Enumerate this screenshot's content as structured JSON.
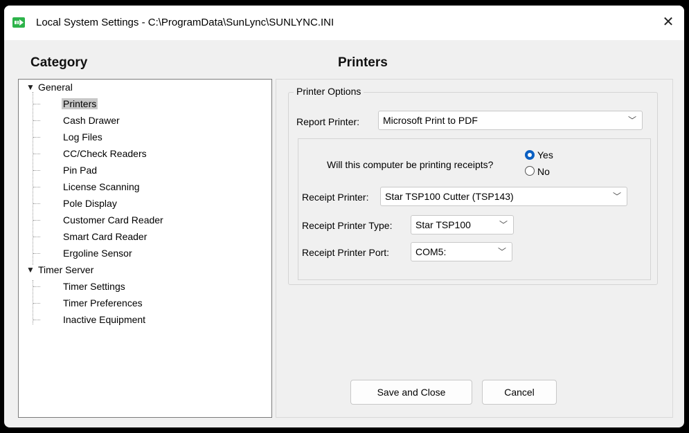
{
  "window": {
    "title": "Local System Settings - C:\\ProgramData\\SunLync\\SUNLYNC.INI",
    "close_glyph": "✕"
  },
  "left": {
    "heading": "Category",
    "tree": [
      {
        "label": "General",
        "level": 0,
        "expanded": true
      },
      {
        "label": "Printers",
        "level": 1,
        "selected": true
      },
      {
        "label": "Cash Drawer",
        "level": 1
      },
      {
        "label": "Log Files",
        "level": 1
      },
      {
        "label": "CC/Check Readers",
        "level": 1
      },
      {
        "label": "Pin Pad",
        "level": 1
      },
      {
        "label": "License Scanning",
        "level": 1
      },
      {
        "label": "Pole Display",
        "level": 1
      },
      {
        "label": "Customer Card Reader",
        "level": 1
      },
      {
        "label": "Smart Card Reader",
        "level": 1
      },
      {
        "label": "Ergoline Sensor",
        "level": 1
      },
      {
        "label": "Timer Server",
        "level": 0,
        "expanded": true
      },
      {
        "label": "Timer Settings",
        "level": 1
      },
      {
        "label": "Timer Preferences",
        "level": 1
      },
      {
        "label": "Inactive Equipment",
        "level": 1
      }
    ]
  },
  "right": {
    "heading": "Printers",
    "group_title": "Printer Options",
    "report_printer_label": "Report Printer:",
    "report_printer_value": "Microsoft Print to PDF",
    "receipts_question": "Will this computer be printing receipts?",
    "yes_label": "Yes",
    "no_label": "No",
    "yes_selected": true,
    "receipt_printer_label": "Receipt Printer:",
    "receipt_printer_value": "Star TSP100 Cutter (TSP143)",
    "receipt_printer_type_label": "Receipt Printer Type:",
    "receipt_printer_type_value": "Star TSP100",
    "receipt_printer_port_label": "Receipt Printer Port:",
    "receipt_printer_port_value": "COM5:",
    "save_label": "Save and Close",
    "cancel_label": "Cancel"
  },
  "colors": {
    "accent": "#0a5fc2",
    "app_icon": "#2db34a",
    "selection": "#c8c8c8"
  }
}
